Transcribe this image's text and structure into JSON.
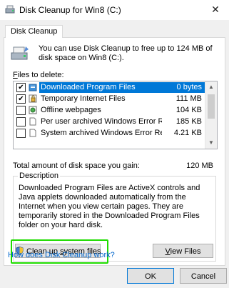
{
  "window": {
    "title": "Disk Cleanup for Win8 (C:)",
    "close": "✕"
  },
  "tab": {
    "label": "Disk Cleanup"
  },
  "header": {
    "text": "You can use Disk Cleanup to free up to 124 MB of disk space on Win8 (C:)."
  },
  "files": {
    "label_prefix": "",
    "label_u": "F",
    "label_rest": "iles to delete:",
    "items": [
      {
        "checked": true,
        "icon": "folder-download-icon",
        "name": "Downloaded Program Files",
        "size": "0 bytes"
      },
      {
        "checked": true,
        "icon": "lock-icon",
        "name": "Temporary Internet Files",
        "size": "111 MB"
      },
      {
        "checked": false,
        "icon": "offline-webpage-icon",
        "name": "Offline webpages",
        "size": "104 KB"
      },
      {
        "checked": false,
        "icon": "document-icon",
        "name": "Per user archived Windows Error Repo...",
        "size": "185 KB"
      },
      {
        "checked": false,
        "icon": "document-icon",
        "name": "System archived Windows Error Repor...",
        "size": "4.21 KB"
      }
    ]
  },
  "total": {
    "label": "Total amount of disk space you gain:",
    "value": "120 MB"
  },
  "description": {
    "legend": "Description",
    "text": "Downloaded Program Files are ActiveX controls and Java applets downloaded automatically from the Internet when you view certain pages. They are temporarily stored in the Downloaded Program Files folder on your hard disk."
  },
  "buttons": {
    "cleanup_prefix": "Clean up ",
    "cleanup_u": "s",
    "cleanup_rest": "ystem files",
    "view_u": "V",
    "view_rest": "iew Files",
    "ok": "OK",
    "cancel": "Cancel"
  },
  "help": {
    "label": "How does Disk Cleanup work?"
  },
  "colors": {
    "selection": "#0078d7",
    "highlight_border": "#1fdc00",
    "link": "#0066cc"
  }
}
